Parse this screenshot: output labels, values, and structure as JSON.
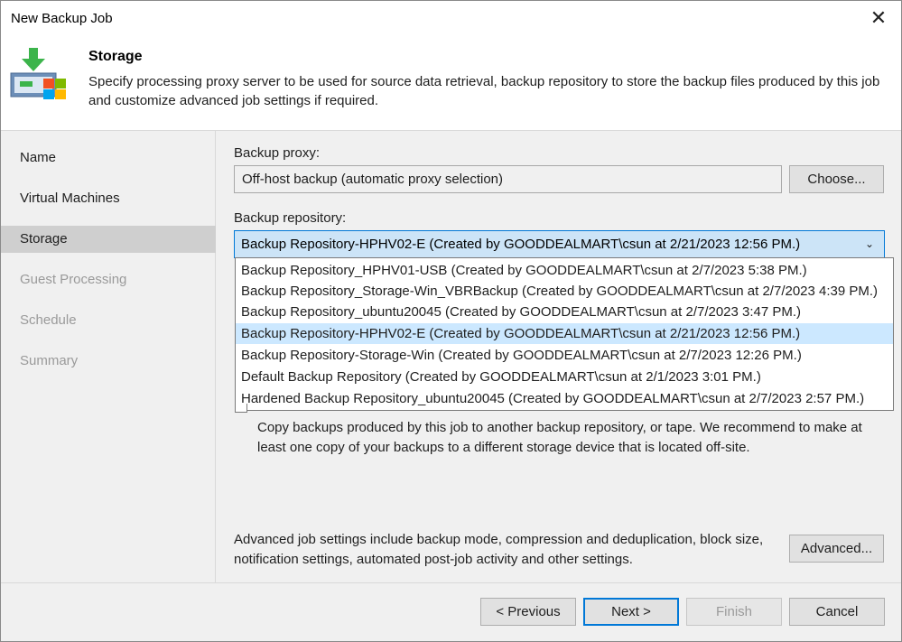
{
  "window": {
    "title": "New Backup Job"
  },
  "header": {
    "title": "Storage",
    "description": "Specify processing proxy server to be used for source data retrieval, backup repository to store the backup files produced by this job and customize advanced job settings if required."
  },
  "sidebar": {
    "items": [
      {
        "label": "Name",
        "state": "normal"
      },
      {
        "label": "Virtual Machines",
        "state": "normal"
      },
      {
        "label": "Storage",
        "state": "active"
      },
      {
        "label": "Guest Processing",
        "state": "disabled"
      },
      {
        "label": "Schedule",
        "state": "disabled"
      },
      {
        "label": "Summary",
        "state": "disabled"
      }
    ]
  },
  "proxy": {
    "label": "Backup proxy:",
    "value": "Off-host backup (automatic proxy selection)",
    "choose_label": "Choose..."
  },
  "repository": {
    "label": "Backup repository:",
    "selected": "Backup Repository-HPHV02-E (Created by GOODDEALMART\\csun at 2/21/2023 12:56 PM.)",
    "options": [
      "Backup Repository_HPHV01-USB (Created by GOODDEALMART\\csun at 2/7/2023 5:38 PM.)",
      "Backup Repository_Storage-Win_VBRBackup (Created by GOODDEALMART\\csun at 2/7/2023 4:39 PM.)",
      "Backup Repository_ubuntu20045 (Created by GOODDEALMART\\csun at 2/7/2023 3:47 PM.)",
      "Backup Repository-HPHV02-E (Created by GOODDEALMART\\csun at 2/21/2023 12:56 PM.)",
      "Backup Repository-Storage-Win (Created by GOODDEALMART\\csun at 2/7/2023 12:26 PM.)",
      "Default Backup Repository (Created by GOODDEALMART\\csun at 2/1/2023 3:01 PM.)",
      "Hardened Backup Repository_ubuntu20045 (Created by GOODDEALMART\\csun at 2/7/2023 2:57 PM.)"
    ],
    "selected_index": 3
  },
  "secondary": {
    "description": "Copy backups produced by this job to another backup repository, or tape. We recommend to make at least one copy of your backups to a different storage device that is located off-site."
  },
  "advanced": {
    "description": "Advanced job settings include backup mode, compression and deduplication, block size, notification settings, automated post-job activity and other settings.",
    "button_label": "Advanced..."
  },
  "footer": {
    "previous_label": "< Previous",
    "next_label": "Next >",
    "finish_label": "Finish",
    "cancel_label": "Cancel"
  },
  "icons": {
    "close": "close-icon",
    "dropdown": "chevron-down-icon",
    "logo": "veeam-backup-job-icon"
  },
  "colors": {
    "selection": "#cce8ff",
    "combo_focus": "#cce4f7",
    "accent": "#0078d7",
    "arrow_green": "#3cb44b"
  }
}
